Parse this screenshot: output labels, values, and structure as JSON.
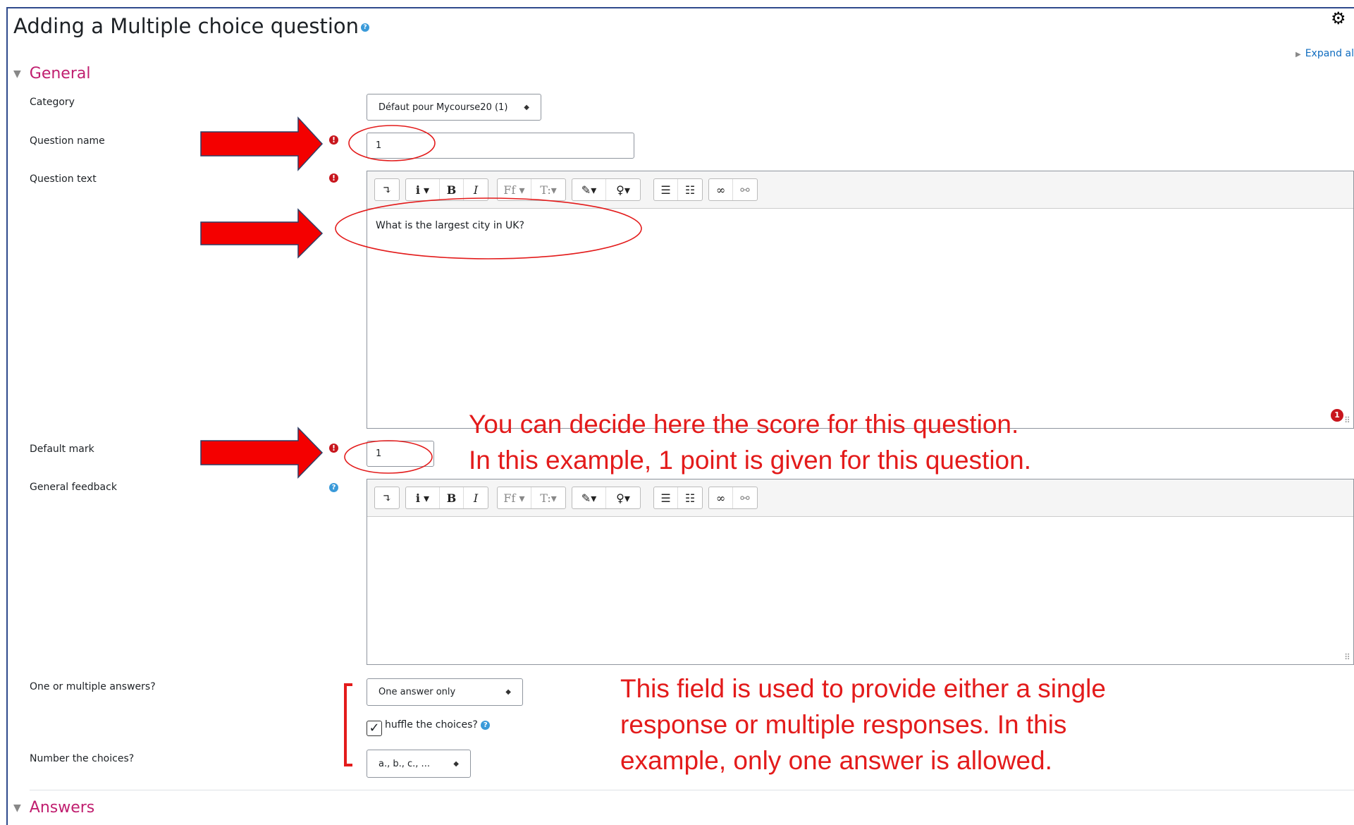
{
  "page": {
    "title": "Adding a Multiple choice question",
    "expand_all": "Expand all"
  },
  "sections": {
    "general": "General",
    "answers": "Answers"
  },
  "labels": {
    "category": "Category",
    "question_name": "Question name",
    "question_text": "Question text",
    "default_mark": "Default mark",
    "general_feedback": "General feedback",
    "one_or_multiple": "One or multiple answers?",
    "shuffle": "huffle the choices?",
    "number_choices": "Number the choices?"
  },
  "fields": {
    "category_value": "Défaut pour Mycourse20 (1)",
    "question_name_value": "1",
    "question_text_value": "What is the largest city in UK?",
    "default_mark_value": "1",
    "one_or_multiple_value": "One answer only",
    "number_choices_value": "a., b., c., ...",
    "shuffle_checked": true,
    "error_badge": "1"
  },
  "annotations": {
    "mark_line1": "You can decide here the score for this question.",
    "mark_line2": "In this example, 1 point is given for this question.",
    "answers_line1": "This field is used to provide either a single",
    "answers_line2": "response or multiple responses. In this",
    "answers_line3": "example, only one answer is allowed."
  },
  "colors": {
    "accent": "#c01e6f",
    "annotation": "#e31b1b",
    "required": "#c8161d",
    "help": "#3a9ad9",
    "arrow": "#f40000"
  },
  "icons": [
    "settings-gear-icon",
    "help-icon",
    "required-icon",
    "collapse-caret-icon",
    "expand-triangle-icon",
    "select-arrows-icon",
    "resize-grip-icon",
    "check-icon",
    "arrow-annotation-icon"
  ]
}
